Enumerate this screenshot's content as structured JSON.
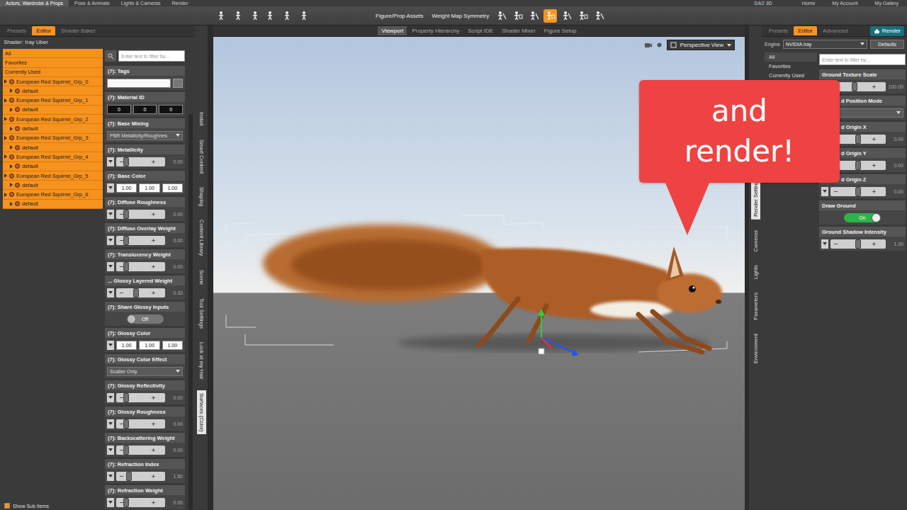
{
  "top_tabs": [
    {
      "label": "Actors, Wardrobe & Props",
      "selected": true
    },
    {
      "label": "Pose & Animate",
      "selected": false
    },
    {
      "label": "Lights & Cameras",
      "selected": false
    },
    {
      "label": "Render",
      "selected": false
    }
  ],
  "logo": "DAZ 3D",
  "top_links": [
    "Home",
    "My Account",
    "My Gallery"
  ],
  "toolbar": {
    "labels": [
      "Figure/Prop Assets",
      "Weight Map Symmetry"
    ],
    "tools": [
      {
        "selected": false
      },
      {
        "selected": false
      },
      {
        "selected": false
      },
      {
        "selected": true
      },
      {
        "selected": false
      },
      {
        "selected": false
      },
      {
        "selected": false
      }
    ]
  },
  "left_panel": {
    "tabs": [
      {
        "label": "Presets",
        "selected": false
      },
      {
        "label": "Editor",
        "selected": true
      },
      {
        "label": "Shader Baker",
        "selected": false
      }
    ],
    "shader": "Shader: Iray Uber",
    "filter_placeholder": "Enter text to filter by...",
    "groups": [
      {
        "label": "All",
        "selected": true
      },
      {
        "label": "Favorites",
        "selected": true
      },
      {
        "label": "Currently Used",
        "selected": true
      }
    ],
    "tree": [
      {
        "label": "European Red Squirrel_Grp_0",
        "selected": true,
        "children": [
          {
            "label": "default",
            "selected": true
          }
        ]
      },
      {
        "label": "European Red Squirrel_Grp_1",
        "selected": true,
        "children": [
          {
            "label": "default",
            "selected": true
          }
        ]
      },
      {
        "label": "European Red Squirrel_Grp_2",
        "selected": true,
        "children": [
          {
            "label": "default",
            "selected": true
          }
        ]
      },
      {
        "label": "European Red Squirrel_Grp_3",
        "selected": true,
        "children": [
          {
            "label": "default",
            "selected": true
          }
        ]
      },
      {
        "label": "European Red Squirrel_Grp_4",
        "selected": true,
        "children": [
          {
            "label": "default",
            "selected": true
          }
        ]
      },
      {
        "label": "European Red Squirrel_Grp_5",
        "selected": true,
        "children": [
          {
            "label": "default",
            "selected": true
          }
        ]
      },
      {
        "label": "European Red Squirrel_Grp_6",
        "selected": true,
        "children": [
          {
            "label": "default",
            "selected": true
          }
        ]
      }
    ],
    "show_sub_items": {
      "label": "Show Sub Items",
      "checked": true
    },
    "properties": [
      {
        "kind": "text",
        "label": "(7): Tags",
        "value": ""
      },
      {
        "kind": "ids",
        "label": "(7): Material ID",
        "values": [
          "0",
          "0",
          "0"
        ]
      },
      {
        "kind": "select",
        "label": "(7): Base Mixing",
        "value": "PBR Metallicity/Roughnes"
      },
      {
        "kind": "slider",
        "label": "(7): Metallicity",
        "value": "0.00",
        "level": 0
      },
      {
        "kind": "color",
        "label": "(7): Base Color",
        "values": [
          "1.00",
          "1.00",
          "1.00"
        ]
      },
      {
        "kind": "slider",
        "label": "(7): Diffuse Roughness",
        "value": "0.00",
        "level": 0
      },
      {
        "kind": "slider",
        "label": "(7): Diffuse Overlay Weight",
        "value": "0.00",
        "level": 0
      },
      {
        "kind": "slider",
        "label": "(7): Translucency Weight",
        "value": "0.00",
        "level": 0
      },
      {
        "kind": "slider",
        "label": "... Glossy Layered Weight",
        "value": "0.33",
        "level": 0.33
      },
      {
        "kind": "toggle",
        "label": "(7): Share Glossy Inputs",
        "value": "Off",
        "on": false
      },
      {
        "kind": "color",
        "label": "(7): Glossy Color",
        "values": [
          "1.00",
          "1.00",
          "1.00"
        ]
      },
      {
        "kind": "select",
        "label": "(7): Glossy Color Effect",
        "value": "Scatter Only"
      },
      {
        "kind": "slider",
        "label": "(7): Glossy Reflectivity",
        "value": "0.00",
        "level": 0
      },
      {
        "kind": "slider",
        "label": "(7): Glossy Roughness",
        "value": "0.00",
        "level": 0
      },
      {
        "kind": "slider",
        "label": "(7): Backscattering Weight",
        "value": "0.00",
        "level": 0
      },
      {
        "kind": "slider",
        "label": "(7): Refraction Index",
        "value": "1.50",
        "level": 0.1
      },
      {
        "kind": "slider",
        "label": "(7): Refraction Weight",
        "value": "0.00",
        "level": 0
      }
    ]
  },
  "side_tabs_left": [
    {
      "label": "Install",
      "selected": false
    },
    {
      "label": "Smart Content",
      "selected": false
    },
    {
      "label": "Shaping",
      "selected": false
    },
    {
      "label": "Content Library",
      "selected": false
    },
    {
      "label": "Scene",
      "selected": false
    },
    {
      "label": "Tool Settings",
      "selected": false
    },
    {
      "label": "Look at my Hair",
      "selected": false
    },
    {
      "label": "Surfaces (Color)",
      "selected": true
    }
  ],
  "viewport": {
    "tabs": [
      {
        "label": "Viewport",
        "selected": true
      },
      {
        "label": "Property Hierarchy",
        "selected": false
      },
      {
        "label": "Script IDE",
        "selected": false
      },
      {
        "label": "Shader Mixer",
        "selected": false
      },
      {
        "label": "Figure Setup",
        "selected": false
      }
    ],
    "view": "Perspective View"
  },
  "side_tabs_right": [
    {
      "label": "Render Settings",
      "selected": true
    },
    {
      "label": "Cameras",
      "selected": false
    },
    {
      "label": "Lights",
      "selected": false
    },
    {
      "label": "Parameters",
      "selected": false
    },
    {
      "label": "Environment",
      "selected": false
    }
  ],
  "right_panel": {
    "tabs": [
      {
        "label": "Presets",
        "selected": false
      },
      {
        "label": "Editor",
        "selected": true
      },
      {
        "label": "Advanced",
        "selected": false
      }
    ],
    "render_button": "Render",
    "engine_label": "Engine",
    "engine": "NVIDIA Iray",
    "defaults_button": "Defaults",
    "filter_placeholder": "Enter text to filter by...",
    "groups": [
      {
        "label": "All",
        "selected": true
      },
      {
        "label": "Favorites",
        "selected": false
      },
      {
        "label": "Currently Used",
        "selected": false
      }
    ],
    "properties": [
      {
        "kind": "slider",
        "label": "Ground Texture Scale",
        "value": "100.00",
        "level": 0.4,
        "covered": false
      },
      {
        "kind": "select",
        "label": "d Position Mode",
        "value": "",
        "covered": true
      },
      {
        "kind": "slider",
        "label": "d Origin X",
        "value": "0.00",
        "level": 0.5,
        "covered": true
      },
      {
        "kind": "slider",
        "label": "d Origin Y",
        "value": "0.00",
        "level": 0.5,
        "covered": true
      },
      {
        "kind": "slider",
        "label": "d Origin Z",
        "value": "0.00",
        "level": 0.5,
        "covered": true
      },
      {
        "kind": "toggle",
        "label": "Draw Ground",
        "value": "On",
        "on": true,
        "covered": false
      },
      {
        "kind": "slider",
        "label": "Ground Shadow Intensity",
        "value": "1.00",
        "level": 0.5,
        "covered": false
      }
    ]
  },
  "callout": "and render!"
}
